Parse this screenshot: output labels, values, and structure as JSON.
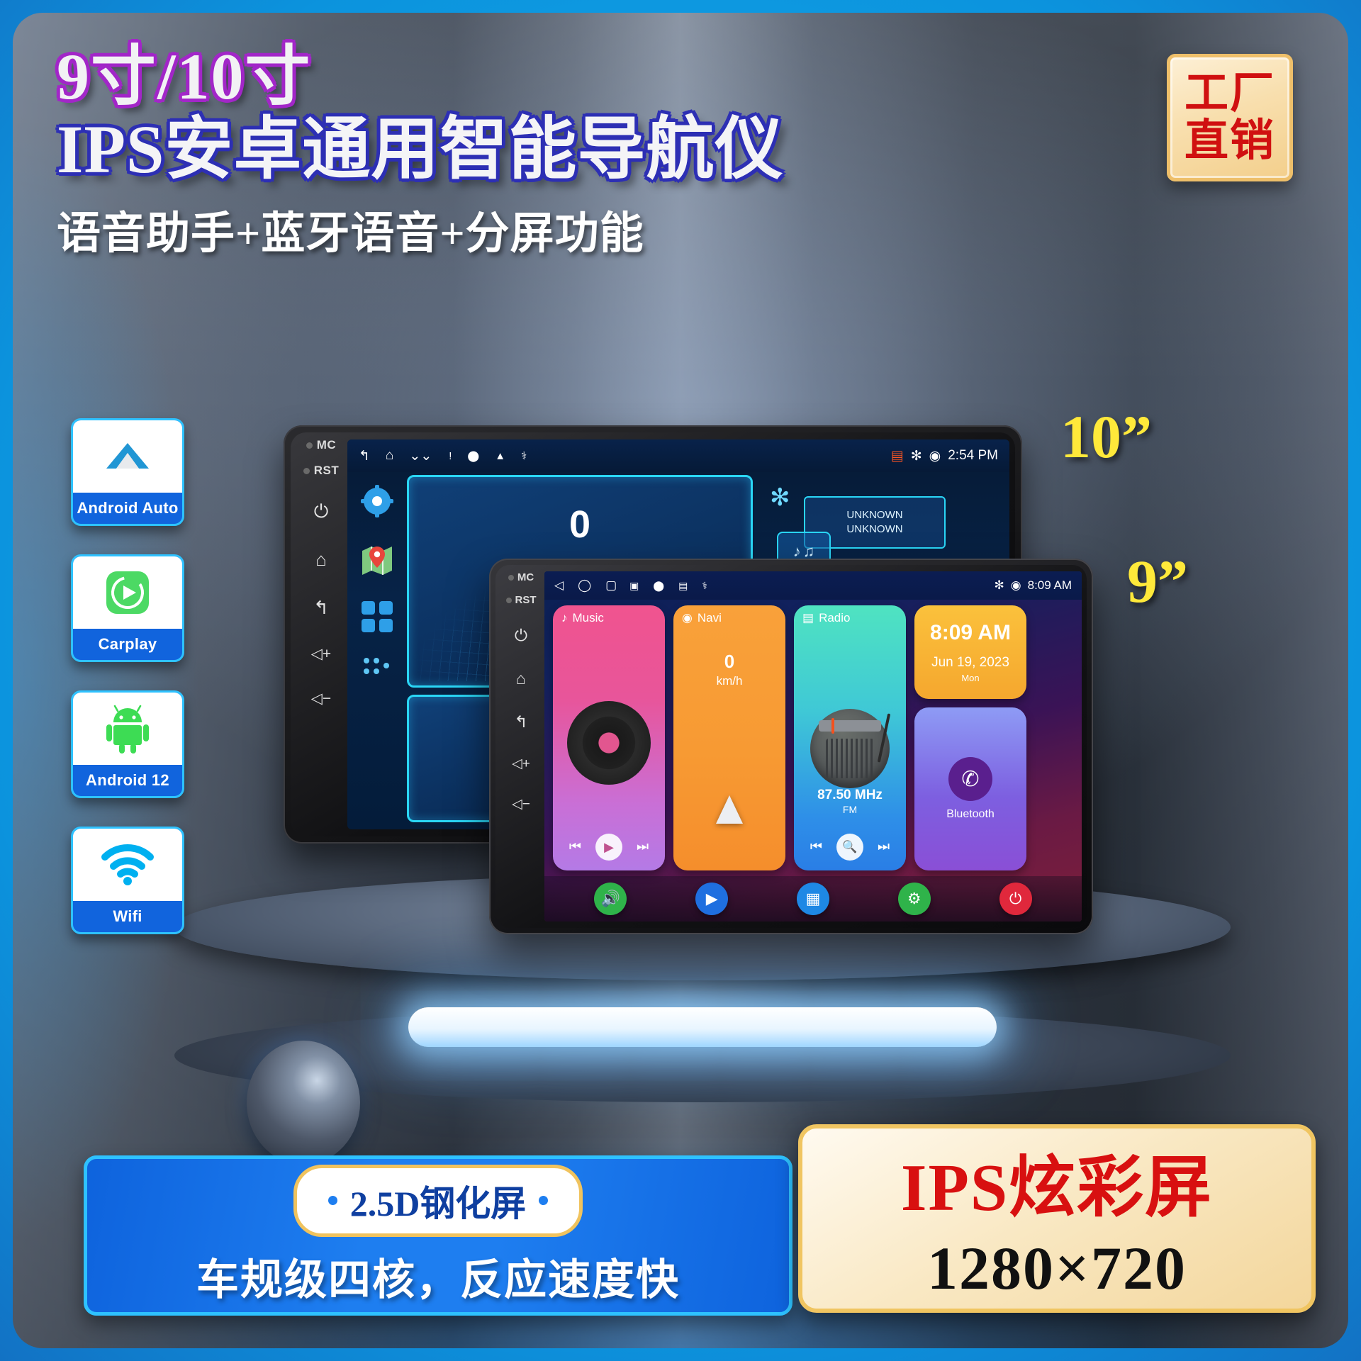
{
  "headline": {
    "line1": "9寸/10寸",
    "line2": "IPS安卓通用智能导航仪",
    "line3": "语音助手+蓝牙语音+分屏功能"
  },
  "factory_badge": {
    "line1": "工厂",
    "line2": "直销"
  },
  "features": [
    {
      "label": "Android Auto",
      "icon": "android-auto-icon"
    },
    {
      "label": "Carplay",
      "icon": "carplay-icon"
    },
    {
      "label": "Android 12",
      "icon": "android-robot-icon"
    },
    {
      "label": "Wifi",
      "icon": "wifi-icon"
    }
  ],
  "size_labels": {
    "ten": "10”",
    "nine": "9”"
  },
  "device10": {
    "side_rail": {
      "mc": "MC",
      "rst": "RST",
      "icons": [
        "power-icon",
        "home-icon",
        "back-icon",
        "volume-up-icon",
        "volume-down-icon"
      ]
    },
    "status_bar": {
      "nav_icons": [
        "back-arrow-icon",
        "home-icon",
        "layers-icon"
      ],
      "tray_icons": [
        "warning-icon",
        "location-pin-icon",
        "alert-triangle-icon",
        "usb-icon"
      ],
      "signal_icon": "signal-off-icon",
      "bluetooth_icon": "bluetooth-icon",
      "gps_icon": "gps-pin-icon",
      "time": "2:54 PM"
    },
    "dock_icons": [
      "settings-gear-icon",
      "maps-icon",
      "apps-grid-icon",
      "more-dots-icon"
    ],
    "widgets": {
      "speed_value": "0",
      "bluetooth_icon": "bluetooth-icon",
      "device_name_line1": "UNKNOWN",
      "device_name_line2": "UNKNOWN",
      "music_icon": "music-note-icon",
      "podcast_icon": "podcast-icon"
    }
  },
  "device9": {
    "side_rail": {
      "mc": "MC",
      "rst": "RST",
      "icons": [
        "power-icon",
        "home-icon",
        "back-icon",
        "volume-up-icon",
        "volume-down-icon"
      ]
    },
    "status_bar": {
      "nav_icons": [
        "back-triangle-icon",
        "home-circle-icon",
        "recents-square-icon"
      ],
      "tray_icons": [
        "sd-card-icon",
        "location-pin-icon",
        "radio-icon",
        "usb-icon"
      ],
      "bluetooth_icon": "bluetooth-icon",
      "gps_icon": "gps-pin-icon",
      "time": "8:09 AM"
    },
    "tiles": [
      {
        "name": "Music",
        "icon": "music-note-icon",
        "controls": [
          "prev-icon",
          "play-icon",
          "next-icon"
        ]
      },
      {
        "name": "Navi",
        "icon": "location-pin-icon",
        "speed_value": "0",
        "speed_unit": "km/h"
      },
      {
        "name": "Radio",
        "icon": "radio-icon",
        "frequency": "87.50 MHz",
        "band": "FM",
        "controls": [
          "prev-icon",
          "search-icon",
          "next-icon"
        ]
      }
    ],
    "clock_widget": {
      "time": "8:09 AM",
      "date": "Jun 19, 2023",
      "weekday": "Mon"
    },
    "bluetooth_widget": {
      "label": "Bluetooth",
      "icon": "phone-icon"
    },
    "dock": [
      {
        "icon": "volume-icon",
        "color": "#2fb34a"
      },
      {
        "icon": "play-icon",
        "color": "#1f6fe0"
      },
      {
        "icon": "apps-grid-icon",
        "color": "#1e88e5"
      },
      {
        "icon": "settings-gear-icon",
        "color": "#2fb34a"
      },
      {
        "icon": "power-icon",
        "color": "#e0283c"
      }
    ]
  },
  "bottom_banner": {
    "pill_text": "2.5D钢化屏",
    "sub_text": "车规级四核，反应速度快"
  },
  "ips_box": {
    "line1": "IPS炫彩屏",
    "line2": "1280×720"
  },
  "colors": {
    "accent_blue": "#1e7ef0",
    "cyan_border": "#2ec2ff",
    "gold": "#f0c561",
    "red": "#d81010",
    "yellow": "#ffe93a"
  }
}
